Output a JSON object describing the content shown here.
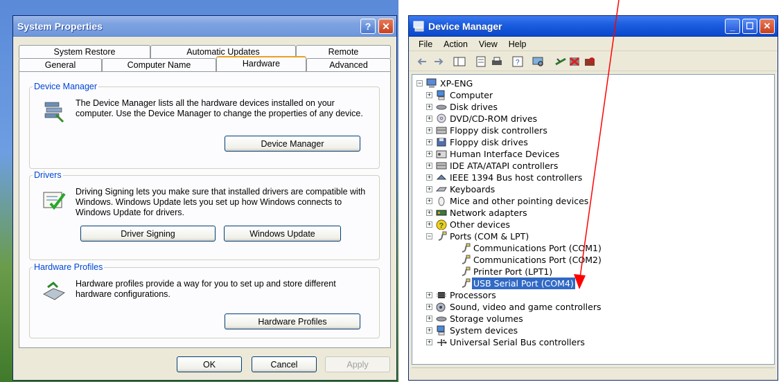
{
  "system_properties": {
    "title": "System Properties",
    "tabs_row1": [
      "System Restore",
      "Automatic Updates",
      "Remote"
    ],
    "tabs_row2": [
      "General",
      "Computer Name",
      "Hardware",
      "Advanced"
    ],
    "active_tab": "Hardware",
    "device_manager": {
      "legend": "Device Manager",
      "text": "The Device Manager lists all the hardware devices installed on your computer. Use the Device Manager to change the properties of any device.",
      "button": "Device Manager"
    },
    "drivers": {
      "legend": "Drivers",
      "text": "Driving Signing lets you make sure that installed drivers are compatible with Windows. Windows Update lets you set up how Windows connects to Windows Update for drivers.",
      "button_signing": "Driver Signing",
      "button_update": "Windows Update"
    },
    "hardware_profiles": {
      "legend": "Hardware Profiles",
      "text": "Hardware profiles provide a way for you to set up and store different hardware configurations.",
      "button": "Hardware Profiles"
    },
    "buttons": {
      "ok": "OK",
      "cancel": "Cancel",
      "apply": "Apply"
    }
  },
  "device_manager": {
    "title": "Device Manager",
    "menu": [
      "File",
      "Action",
      "View",
      "Help"
    ],
    "root": "XP-ENG",
    "categories": [
      "Computer",
      "Disk drives",
      "DVD/CD-ROM drives",
      "Floppy disk controllers",
      "Floppy disk drives",
      "Human Interface Devices",
      "IDE ATA/ATAPI controllers",
      "IEEE 1394 Bus host controllers",
      "Keyboards",
      "Mice and other pointing devices",
      "Network adapters",
      "Other devices",
      "Ports (COM & LPT)"
    ],
    "ports_children": [
      "Communications Port (COM1)",
      "Communications Port (COM2)",
      "Printer Port (LPT1)",
      "USB Serial Port (COM4)"
    ],
    "selected_item": "USB Serial Port (COM4)",
    "categories_after": [
      "Processors",
      "Sound, video and game controllers",
      "Storage volumes",
      "System devices",
      "Universal Serial Bus controllers"
    ]
  },
  "colors": {
    "annotation_arrow": "#ff0000",
    "selection": "#316ac5",
    "group_legend": "#0046d5"
  }
}
